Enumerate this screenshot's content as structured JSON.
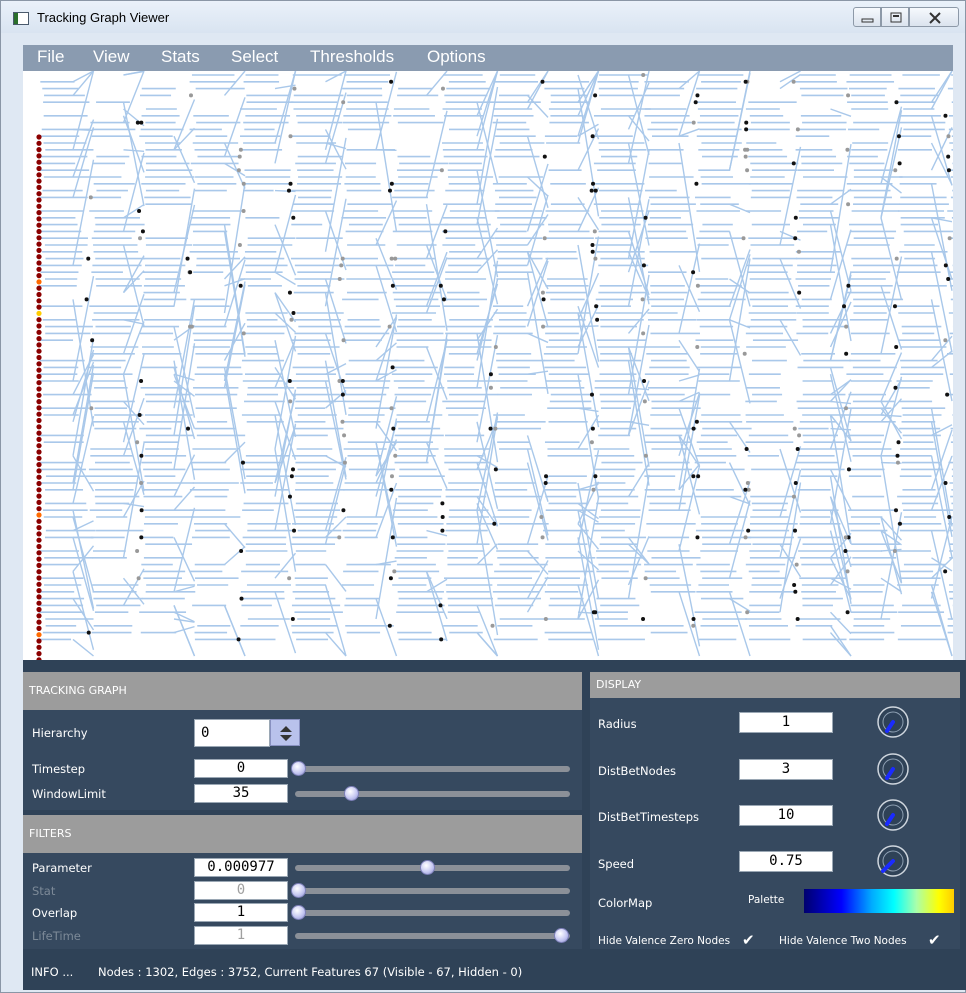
{
  "window": {
    "title": "Tracking Graph Viewer"
  },
  "menu": {
    "items": [
      "File",
      "View",
      "Stats",
      "Select",
      "Thresholds",
      "Options"
    ]
  },
  "tracking_graph": {
    "header": "TRACKING GRAPH",
    "hierarchy": {
      "label": "Hierarchy",
      "value": "0"
    },
    "timestep": {
      "label": "Timestep",
      "value": "0",
      "slider_fraction": 0.0
    },
    "window_limit": {
      "label": "WindowLimit",
      "value": "35",
      "slider_fraction": 0.2
    }
  },
  "filters": {
    "header": "FILTERS",
    "parameter": {
      "label": "Parameter",
      "value": "0.000977",
      "slider_fraction": 0.49
    },
    "stat": {
      "label": "Stat",
      "value": "0",
      "slider_fraction": 0.0
    },
    "overlap": {
      "label": "Overlap",
      "value": "1",
      "slider_fraction": 0.0
    },
    "lifetime": {
      "label": "LifeTime",
      "value": "1",
      "slider_fraction": 1.0
    }
  },
  "display": {
    "header": "DISPLAY",
    "radius": {
      "label": "Radius",
      "value": "1"
    },
    "dist_bet_nodes": {
      "label": "DistBetNodes",
      "value": "3"
    },
    "dist_bet_timesteps": {
      "label": "DistBetTimesteps",
      "value": "10"
    },
    "speed": {
      "label": "Speed",
      "value": "0.75"
    },
    "colormap": {
      "label": "ColorMap",
      "palette_label": "Palette"
    },
    "hide_valence_zero": {
      "label": "Hide Valence Zero Nodes",
      "checked": true
    },
    "hide_valence_two": {
      "label": "Hide Valence Two Nodes",
      "checked": true
    }
  },
  "status": {
    "prefix": "INFO ...",
    "text": "Nodes : 1302, Edges : 3752, Current Features 67 (Visible - 67, Hidden - 0)"
  },
  "graph_colors": {
    "edge": "#a9c8ea",
    "node": "#111111",
    "node_gray": "#999999",
    "first_column": "#8b0000"
  }
}
